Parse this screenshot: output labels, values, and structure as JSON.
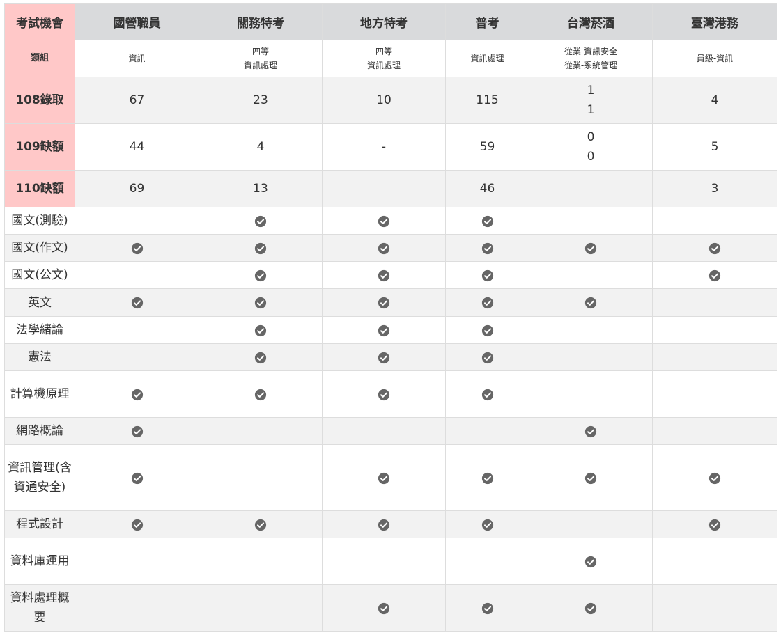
{
  "header": {
    "corner": "考試機會",
    "columns": [
      "國營職員",
      "關務特考",
      "地方特考",
      "普考",
      "台灣菸酒",
      "臺灣港務"
    ]
  },
  "category_row": {
    "label": "類組",
    "cells": [
      [
        "資訊"
      ],
      [
        "四等",
        "資訊處理"
      ],
      [
        "四等",
        "資訊處理"
      ],
      [
        "資訊處理"
      ],
      [
        "從業-資訊安全",
        "從業-系統管理"
      ],
      [
        "員級-資訊"
      ]
    ]
  },
  "count_rows": [
    {
      "label": "108錄取",
      "cells": [
        [
          "67"
        ],
        [
          "23"
        ],
        [
          "10"
        ],
        [
          "115"
        ],
        [
          "1",
          "1"
        ],
        [
          "4"
        ]
      ]
    },
    {
      "label": "109缺額",
      "cells": [
        [
          "44"
        ],
        [
          "4"
        ],
        [
          "-"
        ],
        [
          "59"
        ],
        [
          "0",
          "0"
        ],
        [
          "5"
        ]
      ]
    },
    {
      "label": "110缺額",
      "cells": [
        [
          "69"
        ],
        [
          "13"
        ],
        [],
        [
          "46"
        ],
        [],
        [
          "3"
        ]
      ]
    }
  ],
  "subject_rows": [
    {
      "label": "國文(測驗)",
      "checks": [
        false,
        true,
        true,
        true,
        false,
        false
      ]
    },
    {
      "label": "國文(作文)",
      "checks": [
        true,
        true,
        true,
        true,
        true,
        true
      ]
    },
    {
      "label": "國文(公文)",
      "checks": [
        false,
        true,
        true,
        true,
        false,
        true
      ]
    },
    {
      "label": "英文",
      "checks": [
        true,
        true,
        true,
        true,
        true,
        false
      ]
    },
    {
      "label": "法學緒論",
      "checks": [
        false,
        true,
        true,
        true,
        false,
        false
      ]
    },
    {
      "label": "憲法",
      "checks": [
        false,
        true,
        true,
        true,
        false,
        false
      ]
    },
    {
      "label": "計算機原理",
      "checks": [
        true,
        true,
        true,
        true,
        false,
        false
      ]
    },
    {
      "label": "網路概論",
      "checks": [
        true,
        false,
        false,
        false,
        true,
        false
      ]
    },
    {
      "label": "資訊管理(含資通安全)",
      "checks": [
        true,
        false,
        true,
        true,
        true,
        true
      ]
    },
    {
      "label": "程式設計",
      "checks": [
        true,
        true,
        true,
        true,
        false,
        true
      ]
    },
    {
      "label": "資料庫運用",
      "checks": [
        false,
        false,
        false,
        false,
        true,
        false
      ]
    },
    {
      "label": "資料處理概要",
      "checks": [
        false,
        false,
        true,
        true,
        true,
        false
      ]
    }
  ],
  "colors": {
    "header_bg": "#d9dadc",
    "highlight_bg": "#ffc8c8",
    "stripe_bg": "#f2f2f2",
    "check_color": "#666666"
  },
  "icons": {
    "check": "check-circle-icon"
  }
}
